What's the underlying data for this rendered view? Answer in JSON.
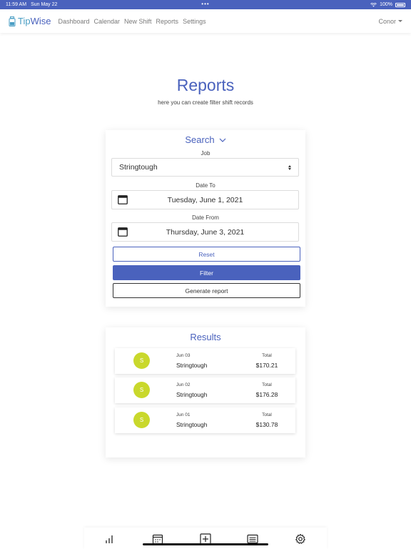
{
  "status_bar": {
    "time": "11:59 AM",
    "date": "Sun May 22",
    "center": "•••",
    "battery": "100%"
  },
  "navbar": {
    "brand_tip": "Tip",
    "brand_wise": "Wise",
    "links": [
      "Dashboard",
      "Calendar",
      "New Shift",
      "Reports",
      "Settings"
    ],
    "user": "Conor"
  },
  "header": {
    "title": "Reports",
    "subtitle": "here you can create filter shift records"
  },
  "search": {
    "heading": "Search",
    "job_label": "Job",
    "job_value": "Stringtough",
    "date_to_label": "Date To",
    "date_to_value": "Tuesday, June 1, 2021",
    "date_from_label": "Date From",
    "date_from_value": "Thursday, June 3, 2021",
    "reset_label": "Reset",
    "filter_label": "Filter",
    "report_label": "Generate report"
  },
  "results": {
    "heading": "Results",
    "items": [
      {
        "initial": "S",
        "date": "Jun 03",
        "job": "Stringtough",
        "total_label": "Total",
        "total": "$170.21"
      },
      {
        "initial": "S",
        "date": "Jun 02",
        "job": "Stringtough",
        "total_label": "Total",
        "total": "$176.28"
      },
      {
        "initial": "S",
        "date": "Jun 01",
        "job": "Stringtough",
        "total_label": "Total",
        "total": "$130.78"
      }
    ]
  },
  "colors": {
    "accent": "#4a62bd",
    "avatar": "#c9d82c"
  },
  "tabbar": {
    "icons": [
      "bar-chart-icon",
      "calendar-icon",
      "add-icon",
      "list-icon",
      "gear-icon"
    ]
  }
}
